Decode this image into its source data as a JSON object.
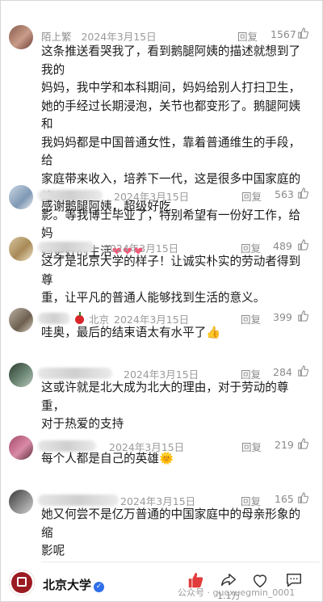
{
  "comments": [
    {
      "name": "陌上繁",
      "date": "2024年3月15日",
      "reply": "回复",
      "likes": "1567",
      "lines": [
        "这条推送看哭我了，看到鹅腿阿姨的描述就想到了我的",
        "妈妈，我中学和本科期间，妈妈给别人打扫卫生，",
        "她的手经过长期浸泡，关节也都变形了。鹅腿阿姨和",
        "我妈妈都是中国普通女性，靠着普通维生的手段，给",
        "家庭带来收入，培养下一代，这是很多中国家庭的缩",
        "影。等我博士毕业了，特别希望有一份好工作，给妈",
        "妈更好的生活"
      ],
      "emoji": "❤❤❤"
    },
    {
      "date": "2024年3月15日",
      "reply": "回复",
      "likes": "563",
      "lines": [
        "感谢鹅腿阿姨，超级好吃"
      ]
    },
    {
      "date": "2024年3月15日",
      "reply": "回复",
      "likes": "489",
      "lines": [
        "这才是北京大学的样子！让诚实朴实的劳动者得到尊",
        "重，让平凡的普通人能够找到生活的意义。"
      ]
    },
    {
      "location": "北京",
      "date": "2024年3月15日",
      "reply": "回复",
      "likes": "399",
      "lines": [
        "哇奥，最后的结束语太有水平了👍"
      ]
    },
    {
      "date": "2024年3月15日",
      "reply": "回复",
      "likes": "284",
      "lines": [
        "这或许就是北大成为北大的理由，对于劳动的尊重，",
        "对于热爱的支持"
      ]
    },
    {
      "date": "2024年3月15日",
      "reply": "回复",
      "likes": "219",
      "lines": [
        "每个人都是自己的英雄🌞"
      ]
    },
    {
      "date": "2024年3月15日",
      "reply": "回复",
      "likes": "165",
      "lines": [
        "她又何尝不是亿万普通的中国家庭中的母亲形象的缩",
        "影呢"
      ]
    }
  ],
  "footer": {
    "account": "北京大学",
    "verified_mark": "✓",
    "share_count": "1.1万",
    "watermark": "公众号 · guoxuegmin_0001",
    "accent": "#9c1b22"
  }
}
